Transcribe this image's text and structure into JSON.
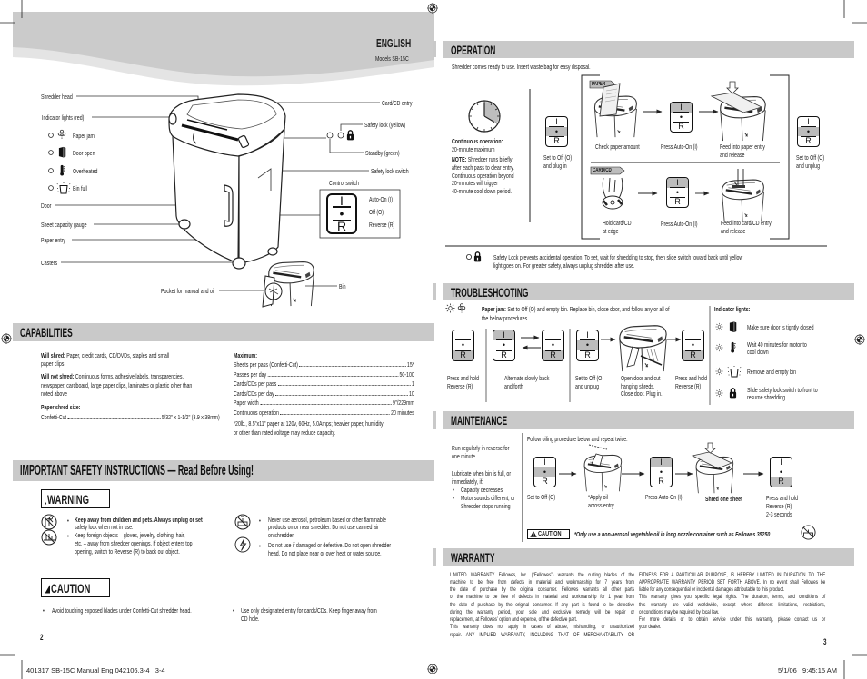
{
  "switch_symbols": {
    "on": "I",
    "off": "•",
    "rev": "R"
  },
  "left_page": {
    "header": {
      "language": "ENGLISH",
      "model": "Models SB-15C"
    },
    "diagram": {
      "shredder_head": "Shredder head",
      "indicator_lights": "Indicator lights (red)",
      "lights": [
        {
          "icon": "paper-jam-icon",
          "label": "Paper jam"
        },
        {
          "icon": "door-open-icon",
          "label": "Door open"
        },
        {
          "icon": "overheated-icon",
          "label": "Overheated"
        },
        {
          "icon": "bin-full-icon",
          "label": "Bin full"
        }
      ],
      "door": "Door",
      "sheet_capacity_gauge": "Sheet capacity gauge",
      "paper_entry": "Paper entry",
      "casters": "Casters",
      "pocket": "Pocket for manual and oil",
      "bin": "Bin",
      "card_cd_entry": "Card/CD entry",
      "safety_lock_yellow": "Safety lock (yellow)",
      "standby_green": "Standby (green)",
      "safety_lock_switch": "Safety lock switch",
      "control_switch": {
        "title": "Control switch",
        "position": "none",
        "labels": [
          "Auto-On (I)",
          "Off (O)",
          "Reverse (R)"
        ]
      }
    },
    "capabilities": {
      "title": "CAPABILITIES",
      "will_shred": {
        "label": "Will shred:",
        "lines": [
          "Paper, credit cards, CD/DVDs, staples and small",
          "paper clips"
        ]
      },
      "will_not_shred": {
        "label": "Will not shred:",
        "lines": [
          "Continuous forms, adhesive labels, transparencies,",
          "newspaper, cardboard, large paper clips, laminates or plastic other than",
          "noted above"
        ]
      },
      "shred_size": {
        "label": "Paper shred size:",
        "name": "Confetti-Cut",
        "value": "5/32\" x 1-1/2\" (3.9 x 38mm)"
      },
      "maximum": {
        "label": "Maximum:",
        "rows": [
          {
            "name": "Sheets per pass (Confetti-Cut)",
            "value": "15*"
          },
          {
            "name": "Passes per day",
            "value": "50-100"
          },
          {
            "name": "Cards/CDs per pass",
            "value": "1"
          },
          {
            "name": "Cards/CDs per day",
            "value": "10"
          },
          {
            "name": "Paper width",
            "value": "9\"/229mm"
          },
          {
            "name": "Continuous operation",
            "value": "20 minutes"
          }
        ]
      },
      "footnote": [
        "*20lb., 8.5\"x11\" paper at 120v, 60Hz, 5.0Amps; heavier paper, humidity",
        "or other than rated voltage may reduce capacity."
      ]
    },
    "safety": {
      "title": "IMPORTANT SAFETY INSTRUCTIONS — Read Before Using!",
      "warning_label": "WARNING",
      "bullet": "•",
      "warnings_left": [
        {
          "icon": "keep-away-from-children-icon",
          "lines": [
            "Keep away from children and pets. Always unplug or set",
            "safety lock when not in use."
          ]
        },
        {
          "icon": "keep-objects-away-icon",
          "lines": [
            "Keep foreign objects – gloves, jewelry, clothing, hair,",
            "etc. – away from shredder openings. If object enters top",
            "opening, switch to Reverse (R) to back out object."
          ]
        }
      ],
      "warnings_right": [
        {
          "icon": "no-aerosol-icon",
          "lines": [
            "Never use aerosol, petroleum based or other flammable",
            "products on or near shredder. Do not use canned air",
            "on shredder."
          ]
        },
        {
          "icon": "electrical-hazard-icon",
          "lines": [
            "Do not use if damaged or defective. Do not open shredder",
            "head. Do not place near or over heat or water source."
          ]
        }
      ],
      "caution_label": "CAUTION",
      "cautions": [
        {
          "lines": [
            "Avoid touching exposed blades under Confetti-Cut shredder head."
          ]
        },
        {
          "lines": [
            "Use only designated entry for cards/CDs. Keep finger away from",
            "CD hole."
          ]
        }
      ]
    },
    "page_number": "2"
  },
  "right_page": {
    "operation": {
      "title": "OPERATION",
      "intro": "Shredder comes ready to use. Insert waste bag for easy disposal.",
      "continuous": {
        "label": "Continuous operation:",
        "value": "20-minute maximum",
        "note_label": "NOTE:",
        "note_lines": [
          "Shredder runs briefly",
          "after each pass to clear entry.",
          "Continuous operation beyond",
          "20-minutes will trigger",
          "40-minute cool  down period."
        ]
      },
      "start": {
        "switch": "off",
        "caption": [
          "Set to Off (O)",
          "and plug in"
        ]
      },
      "paper": {
        "tag": "PAPER",
        "steps": [
          {
            "caption": [
              "Check paper amount"
            ]
          },
          {
            "switch": "on",
            "caption": [
              "Press Auto-On (I)"
            ]
          },
          {
            "caption": [
              "Feed into paper entry",
              "and release"
            ]
          }
        ]
      },
      "card_cd": {
        "tag": "CARD/CD",
        "steps": [
          {
            "caption": [
              "Hold card/CD",
              "at edge"
            ]
          },
          {
            "switch": "on",
            "caption": [
              "Press Auto-On (I)"
            ]
          },
          {
            "caption": [
              "Feed into card/CD entry",
              "and release"
            ]
          }
        ]
      },
      "end": {
        "switch": "off",
        "caption": [
          "Set to Off (O)",
          "and unplug"
        ]
      },
      "safety_lock": [
        "Safety Lock prevents accidental operation. To set, wait for shredding to stop, then slide switch toward back until yellow",
        "light goes on. For greater safety, always unplug shredder after use."
      ]
    },
    "troubleshooting": {
      "title": "TROUBLESHOOTING",
      "paper_jam": {
        "label": "Paper jam:",
        "lines": [
          "Set to Off (O) and empty bin. Replace bin, close door, and follow any or all of",
          "the below procedures."
        ]
      },
      "steps": [
        {
          "switches": [
            "rev"
          ],
          "caption": [
            "Press and hold",
            "Reverse (R)"
          ]
        },
        {
          "switches": [
            "on",
            "rev"
          ],
          "caption": [
            "Alternate slowly back",
            "and forth"
          ]
        },
        {
          "switches": [
            "off"
          ],
          "caption": [
            "Set to Off (O",
            "and unplug"
          ]
        },
        {
          "caption": [
            "Open door and cut",
            "hanging shreds.",
            "Close door. Plug in."
          ]
        },
        {
          "switches": [
            "rev"
          ],
          "caption": [
            "Press and hold",
            "Reverse (R)"
          ]
        }
      ],
      "indicator_lights": {
        "title": "Indicator lights:",
        "rows": [
          {
            "icon": "door-open-icon",
            "lines": [
              "Make sure door is tightly closed"
            ]
          },
          {
            "icon": "overheated-icon",
            "lines": [
              "Wait 40 minutes for motor to",
              "cool down"
            ]
          },
          {
            "icon": "bin-full-icon",
            "lines": [
              "Remove and empty bin"
            ]
          },
          {
            "icon": "lock-icon",
            "lines": [
              "Slide safety lock switch to front to",
              "resume shredding"
            ]
          }
        ]
      }
    },
    "maintenance": {
      "title": "MAINTENANCE",
      "notes": {
        "p1": [
          "Run regularly in reverse for",
          "one minute"
        ],
        "p2": [
          "Lubricate when bin is full, or",
          "immediately, if:"
        ],
        "bullets": [
          [
            "Capacity decreases"
          ],
          [
            "Motor sounds different, or",
            "Shredder stops running"
          ]
        ]
      },
      "intro": "Follow oiling procedure below and repeat twice.",
      "steps": [
        {
          "switch": "off",
          "caption": [
            "Set to Off (O)"
          ]
        },
        {
          "caption": [
            "*Apply oil",
            "across entry"
          ]
        },
        {
          "switch": "on",
          "caption": [
            "Press Auto-On (I)"
          ]
        },
        {
          "caption": [
            "Shred one sheet"
          ]
        },
        {
          "switch": "rev",
          "caption": [
            "Press and hold",
            "Reverse (R)",
            "2-3 seconds"
          ]
        }
      ],
      "caution_label": "CAUTION",
      "caution_text": "*Only use a non-aerosol vegetable oil in long nozzle container such as Fellowes 35250"
    },
    "warranty": {
      "title": "WARRANTY",
      "left": [
        [
          "LIMITED WARRANTY Fellowes, Inc. (“Fellowes”) warrants the cutting blades of the",
          "machine to be free from defects in material and workmanship for 7 years from",
          "the date of purchase by the original consumer. Fellowes warrants all other parts",
          "of the machine to be free of defects in material and workmanship for 1 year from",
          "the date of purchase by the original consumer. If any part is found to be defective",
          "during the warranty period, your sole and exclusive remedy will be repair or",
          "replacement, at Fellowes’ option and expense, of the defective part."
        ],
        [
          "This warranty does not apply in cases of abuse, mishandling, or unauthorized",
          "repair. ANY IMPLIED WARRANTY, INCLUDING THAT OF MERCHANTABILITY OR"
        ]
      ],
      "right": [
        [
          "FITNESS FOR A PARTICULAR PURPOSE, IS HEREBY LIMITED IN DURATION TO THE",
          "APPROPRIATE WARRANTY PERIOD SET FORTH ABOVE. In no event shall Fellowes be",
          "liable for any consequential or incidental damages attributable to this product."
        ],
        [
          "This warranty gives you specific legal rights. The duration, terms, and conditions of",
          "this warranty are valid worldwide, except where different limitations, restrictions,",
          "or conditions may be required by local law."
        ],
        [
          "For more details or to obtain service under this warranty, please contact us or",
          "your dealer."
        ]
      ]
    },
    "page_number": "3"
  },
  "footer": {
    "job": "401317 SB-15C Manual Eng 042106.3-4   3-4",
    "timestamp": "5/1/06   9:45:15 AM"
  }
}
